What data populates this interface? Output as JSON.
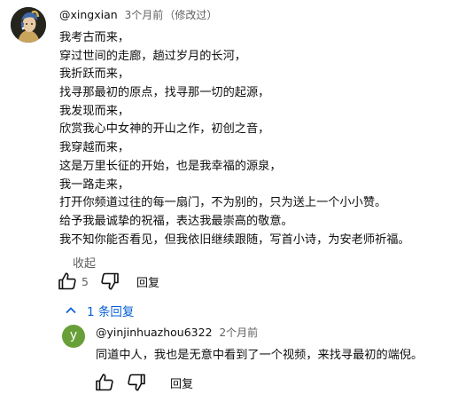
{
  "comment": {
    "author": "@xingxian",
    "time": "3个月前",
    "edited": "（修改过）",
    "lines": [
      "我考古而来，",
      "穿过世间的走廊，趟过岁月的长河，",
      "我折跃而来，",
      "找寻那最初的原点，找寻那一切的起源，",
      "我发现而来，",
      "欣赏我心中女神的开山之作，初创之音，",
      "我穿越而来，",
      "这是万里长征的开始，也是我幸福的源泉，",
      "我一路走来，",
      "打开你频道过往的每一扇门，不为别的，只为送上一个小小赞。",
      "给予我最诚挚的祝福，表达我最崇高的敬意。",
      "我不知你能否看见，但我依旧继续跟随，写首小诗，为安老师祈福。"
    ],
    "collapse_label": "收起",
    "like_count": "5",
    "reply_label": "回复"
  },
  "replies_toggle": {
    "label": "1 条回复"
  },
  "reply": {
    "avatar_letter": "y",
    "author": "@yinjinhuazhou6322",
    "time": "2个月前",
    "text": "同道中人，我也是无意中看到了一个视频，来找寻最初的端倪。",
    "reply_label": "回复"
  },
  "colors": {
    "link_blue": "#065fd4",
    "reply_avatar_green": "#689f38",
    "secondary_text": "#606060"
  },
  "icons": [
    "avatar-portrait",
    "thumb-up-icon",
    "thumb-down-icon",
    "chevron-up-icon"
  ]
}
